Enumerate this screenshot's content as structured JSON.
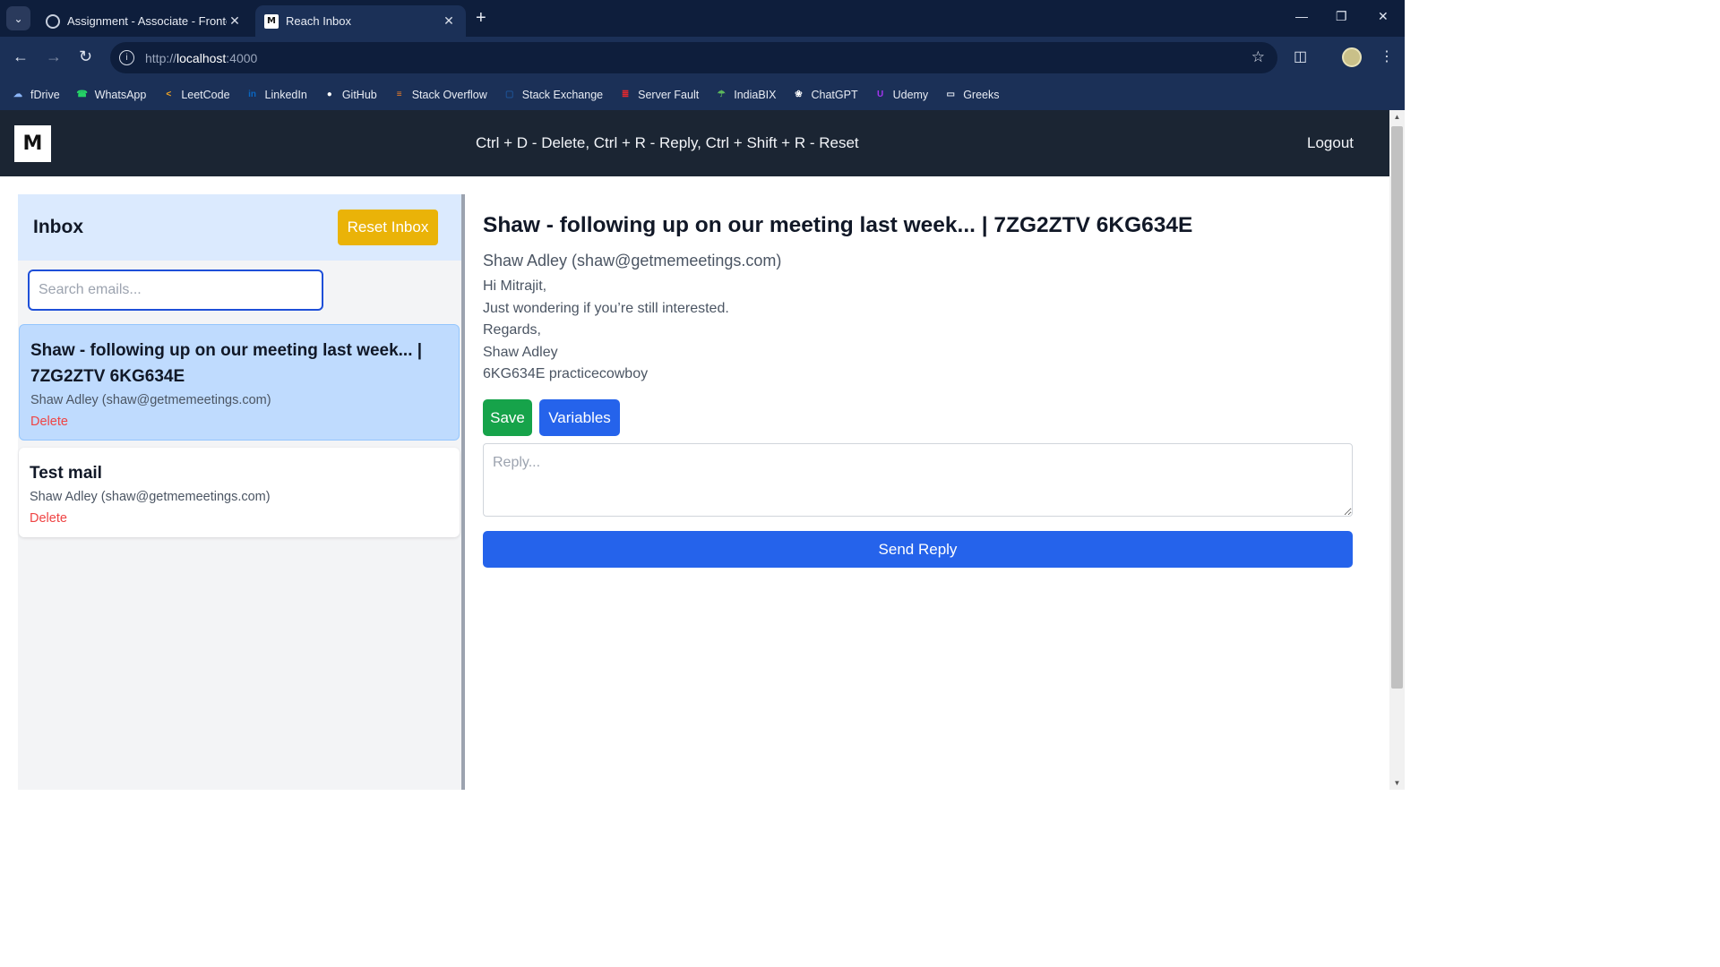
{
  "browser": {
    "tabs": [
      {
        "title": "Assignment - Associate - Fronte",
        "icon": "globe-icon"
      },
      {
        "title": "Reach Inbox",
        "icon": "m-logo-icon"
      }
    ],
    "new_tab_glyph": "+",
    "url_scheme": "http://",
    "url_host": "localhost",
    "url_port": ":4000",
    "bookmarks": [
      {
        "label": "fDrive",
        "icon": "cloud-icon",
        "color": "#8ab4f8"
      },
      {
        "label": "WhatsApp",
        "icon": "whatsapp-icon",
        "color": "#25d366"
      },
      {
        "label": "LeetCode",
        "icon": "leetcode-icon",
        "color": "#f5a623"
      },
      {
        "label": "LinkedIn",
        "icon": "linkedin-icon",
        "color": "#0a66c2"
      },
      {
        "label": "GitHub",
        "icon": "github-icon",
        "color": "#ffffff"
      },
      {
        "label": "Stack Overflow",
        "icon": "stackoverflow-icon",
        "color": "#f48024"
      },
      {
        "label": "Stack Exchange",
        "icon": "stackexchange-icon",
        "color": "#1e5397"
      },
      {
        "label": "Server Fault",
        "icon": "serverfault-icon",
        "color": "#e7282d"
      },
      {
        "label": "IndiaBIX",
        "icon": "indiabix-icon",
        "color": "#5cb85c"
      },
      {
        "label": "ChatGPT",
        "icon": "chatgpt-icon",
        "color": "#ffffff"
      },
      {
        "label": "Udemy",
        "icon": "udemy-icon",
        "color": "#a435f0"
      },
      {
        "label": "Greeks",
        "icon": "folder-icon",
        "color": "#dfe5f0"
      }
    ]
  },
  "header": {
    "logo": "M",
    "shortcuts": "Ctrl + D - Delete, Ctrl + R - Reply, Ctrl + Shift + R - Reset",
    "logout_label": "Logout"
  },
  "sidebar": {
    "title": "Inbox",
    "reset_label": "Reset Inbox",
    "search_placeholder": "Search emails...",
    "emails": [
      {
        "subject": "Shaw - following up on our meeting last week... | 7ZG2ZTV 6KG634E",
        "from": "Shaw Adley (shaw@getmemeetings.com)",
        "delete_label": "Delete",
        "selected": true
      },
      {
        "subject": "Test mail",
        "from": "Shaw Adley (shaw@getmemeetings.com)",
        "delete_label": "Delete",
        "selected": false
      }
    ]
  },
  "detail": {
    "subject": "Shaw - following up on our meeting last week... | 7ZG2ZTV 6KG634E",
    "from": "Shaw Adley (shaw@getmemeetings.com)",
    "body_lines": [
      "Hi Mitrajit,",
      "Just wondering if you’re still interested.",
      "Regards,",
      "Shaw Adley",
      "6KG634E practicecowboy"
    ],
    "save_label": "Save",
    "variables_label": "Variables",
    "reply_placeholder": "Reply...",
    "send_label": "Send Reply"
  },
  "colors": {
    "header_bg": "#1b2533",
    "inbox_head_bg": "#dbeafe",
    "selected_card_bg": "#bfdbfe",
    "reset_btn": "#eab308",
    "save_btn": "#16a34a",
    "primary_btn": "#2563eb",
    "delete_text": "#ef4444"
  }
}
